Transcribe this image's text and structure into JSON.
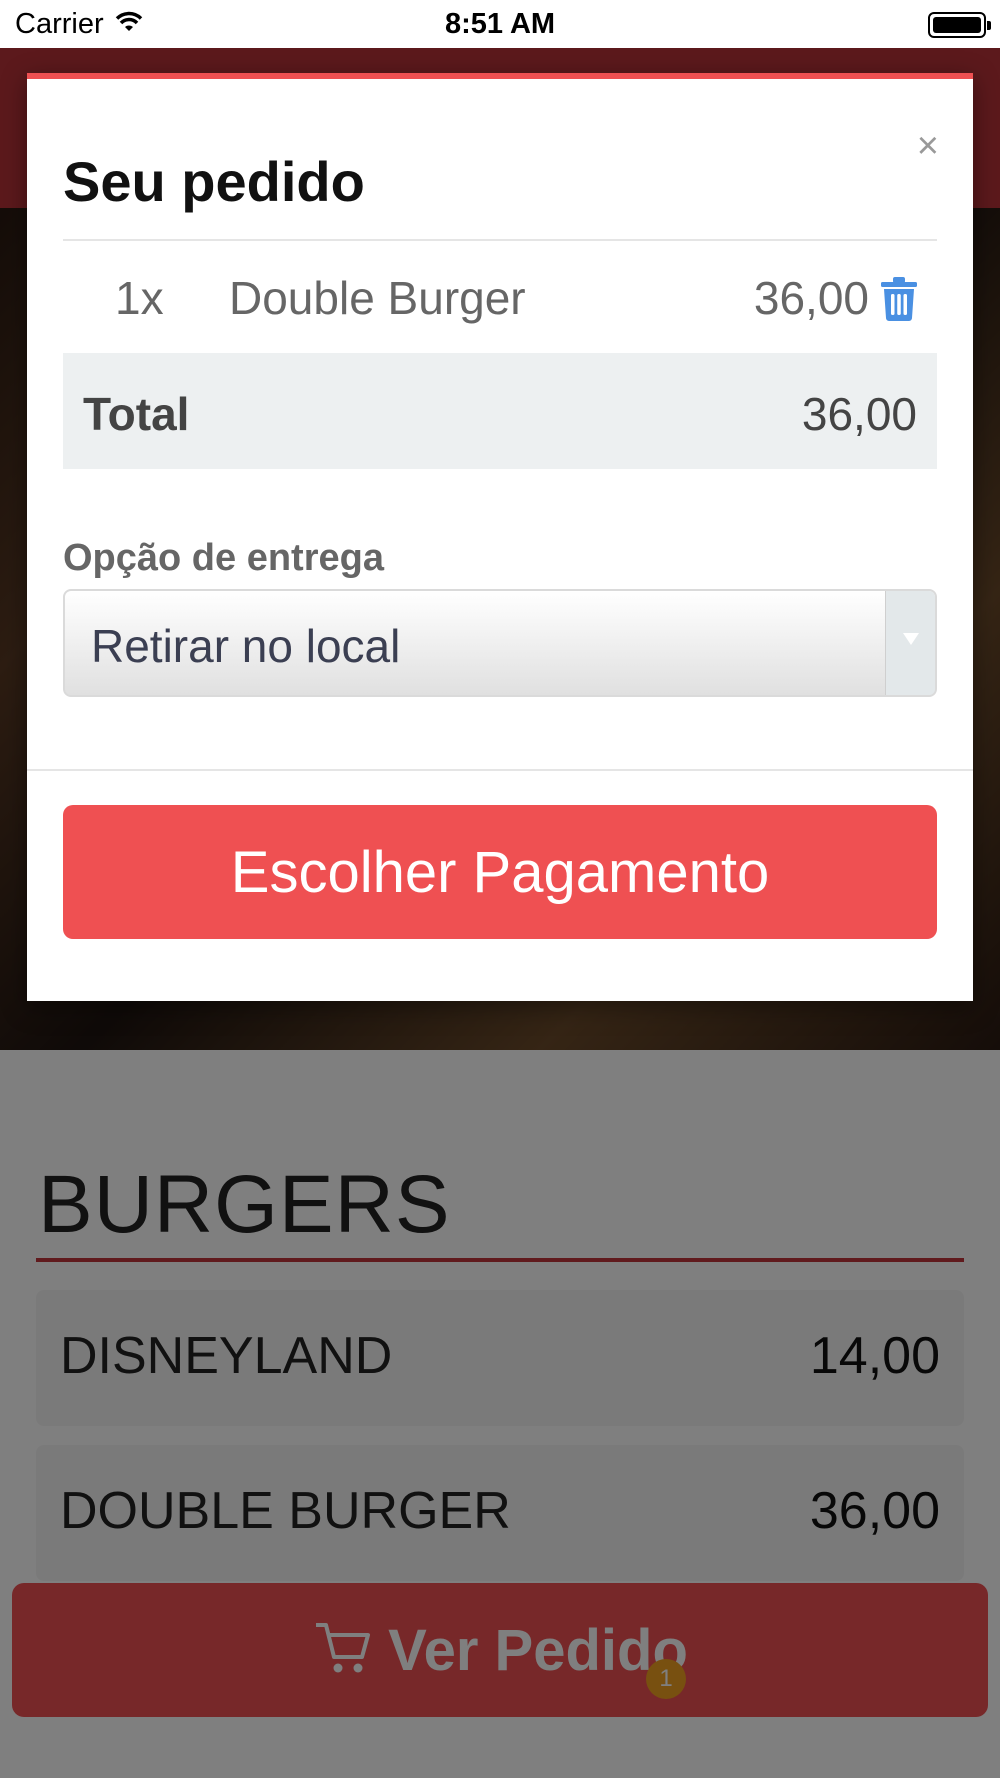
{
  "status_bar": {
    "carrier": "Carrier",
    "time": "8:51 AM"
  },
  "modal": {
    "title": "Seu pedido",
    "close_label": "×",
    "order_items": [
      {
        "quantity": "1x",
        "name": "Double Burger",
        "price": "36,00"
      }
    ],
    "total_label": "Total",
    "total_value": "36,00",
    "delivery_label": "Opção de entrega",
    "delivery_selected": "Retirar no local",
    "pay_button_label": "Escolher Pagamento"
  },
  "menu": {
    "section_title": "BURGERS",
    "items": [
      {
        "name": "DISNEYLAND",
        "price": "14,00"
      },
      {
        "name": "DOUBLE BURGER",
        "price": "36,00"
      }
    ]
  },
  "cart": {
    "button_label": "Ver Pedido",
    "badge_count": "1"
  },
  "colors": {
    "accent": "#ef5052",
    "header": "#b83338",
    "trash_icon": "#4a90e2",
    "badge": "#f0a020"
  }
}
